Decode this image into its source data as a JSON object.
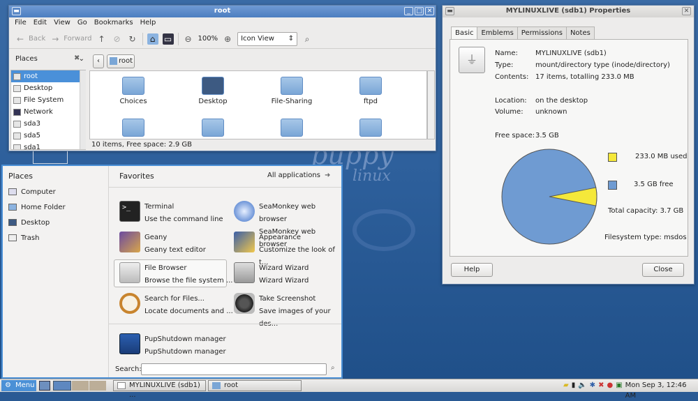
{
  "file_manager": {
    "title": "root",
    "menu": [
      "File",
      "Edit",
      "View",
      "Go",
      "Bookmarks",
      "Help"
    ],
    "toolbar": {
      "back": "Back",
      "forward": "Forward",
      "zoom": "100%",
      "view_mode": "Icon View"
    },
    "places_label": "Places",
    "sidebar": [
      "root",
      "Desktop",
      "File System",
      "Network",
      "sda3",
      "sda5",
      "sda1"
    ],
    "path_button": "root",
    "icons": [
      "Choices",
      "Desktop",
      "File-Sharing",
      "ftpd"
    ],
    "status": "10 items, Free space: 2.9 GB"
  },
  "properties": {
    "title": "MYLINUXLIVE (sdb1) Properties",
    "tabs": [
      "Basic",
      "Emblems",
      "Permissions",
      "Notes"
    ],
    "name_label": "Name:",
    "name": "MYLINUXLIVE (sdb1)",
    "type_label": "Type:",
    "type": "mount/directory type (inode/directory)",
    "contents_label": "Contents:",
    "contents": "17 items, totalling 233.0 MB",
    "location_label": "Location:",
    "location": "on the desktop",
    "volume_label": "Volume:",
    "volume": "unknown",
    "free_label": "Free space:",
    "free": "3.5 GB",
    "used_legend": "233.0 MB used",
    "free_legend": "3.5 GB free",
    "capacity": "Total capacity: 3.7 GB",
    "fstype": "Filesystem type: msdos",
    "help": "Help",
    "close": "Close",
    "pie": {
      "used_fraction": 0.0615,
      "used_color": "#f5e83a",
      "free_color": "#6f9bd2"
    }
  },
  "menu_panel": {
    "places_title": "Places",
    "places": [
      "Computer",
      "Home Folder",
      "Desktop",
      "Trash"
    ],
    "favorites_title": "Favorites",
    "all_apps": "All applications",
    "favorites": [
      {
        "name": "Terminal",
        "desc": "Use the command line",
        "icon": "terminal-icon"
      },
      {
        "name": "SeaMonkey web browser",
        "desc": "SeaMonkey web browser",
        "icon": "browser-icon"
      },
      {
        "name": "Geany",
        "desc": "Geany text editor",
        "icon": "geany-icon"
      },
      {
        "name": "Appearance",
        "desc": "Customize the look of t...",
        "icon": "appearance-icon"
      },
      {
        "name": "File Browser",
        "desc": "Browse the file system ...",
        "icon": "file-cabinet-icon"
      },
      {
        "name": "Wizard Wizard",
        "desc": "Wizard Wizard",
        "icon": "wizard-icon"
      },
      {
        "name": "Search for Files...",
        "desc": "Locate documents and ...",
        "icon": "magnifier-icon"
      },
      {
        "name": "Take Screenshot",
        "desc": "Save images of your des...",
        "icon": "camera-icon"
      },
      {
        "name": "PupShutdown manager",
        "desc": "PupShutdown manager",
        "icon": "shutdown-icon"
      }
    ],
    "search_label": "Search:"
  },
  "taskbar": {
    "menu": "Menu",
    "tasks": [
      "MYLINUXLIVE (sdb1) ...",
      "root"
    ],
    "clock": "Mon Sep  3, 12:46 AM"
  },
  "wallpaper": {
    "brand_top": "puppy",
    "brand_bottom": "linux"
  }
}
